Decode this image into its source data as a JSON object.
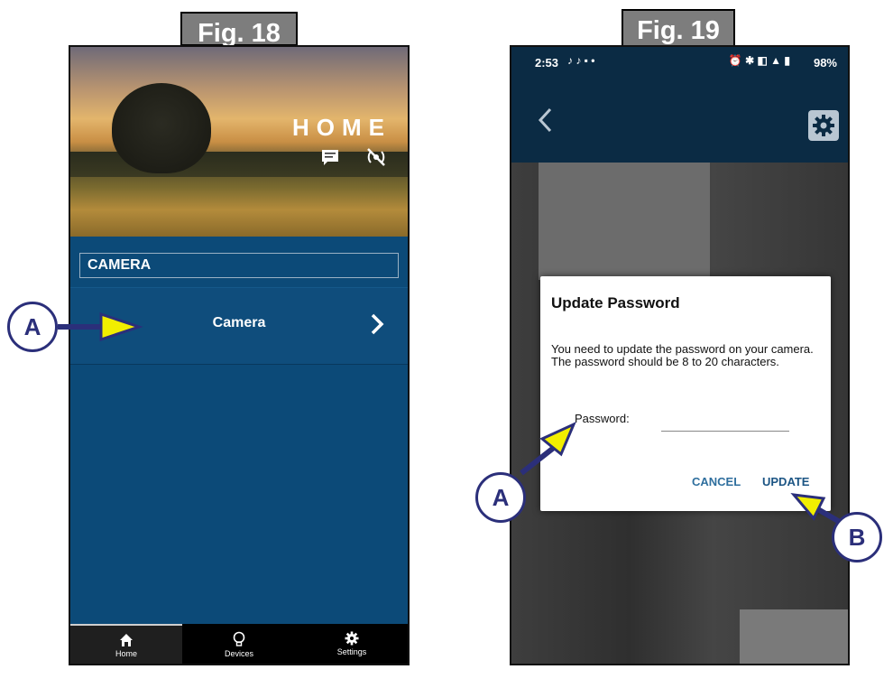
{
  "fig18": {
    "label": "Fig. 18",
    "home_title": "HOME",
    "section_header": "CAMERA",
    "camera_item": "Camera",
    "tabs": [
      {
        "label": "Home",
        "icon": "home-icon"
      },
      {
        "label": "Devices",
        "icon": "lightbulb-icon"
      },
      {
        "label": "Settings",
        "icon": "gear-icon"
      }
    ],
    "callout": "A"
  },
  "fig19": {
    "label": "Fig. 19",
    "status_time": "2:53",
    "status_right": "98%",
    "dialog": {
      "title": "Update Password",
      "message": "You need to update the password on your camera. The password should be 8 to 20 characters.",
      "password_label": "Password:",
      "cancel": "CANCEL",
      "update": "UPDATE"
    },
    "callout_a": "A",
    "callout_b": "B"
  },
  "colors": {
    "app_blue": "#0c4a78",
    "header_dark": "#0b2b44",
    "callout_navy": "#2b2f7a",
    "arrow_yellow": "#f2ee00"
  }
}
